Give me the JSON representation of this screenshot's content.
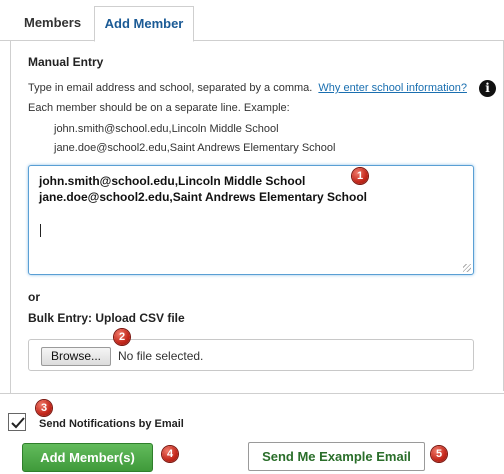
{
  "tabs": [
    {
      "label": "Members"
    },
    {
      "label": "Add Member"
    }
  ],
  "manual_entry": {
    "title": "Manual Entry",
    "instruction_1": "Type in email address and school, separated by a comma.",
    "why_link": "Why enter school information?",
    "info_icon": "i",
    "instruction_2": "Each member should be on a separate line. Example:",
    "examples": [
      "john.smith@school.edu,Lincoln Middle School",
      "jane.doe@school2.edu,Saint Andrews Elementary School"
    ],
    "textarea_lines": [
      "john.smith@school.edu,Lincoln Middle School",
      "jane.doe@school2.edu,Saint Andrews Elementary School"
    ]
  },
  "bulk": {
    "or_label": "or",
    "title": "Bulk Entry: Upload CSV file",
    "browse_label": "Browse...",
    "file_status": "No file selected."
  },
  "notifications": {
    "label": "Send Notifications by Email",
    "checked": true
  },
  "actions": {
    "add_label": "Add Member(s)",
    "example_label": "Send Me Example Email",
    "add_color": "#4caf50"
  },
  "markers": [
    "1",
    "2",
    "3",
    "4",
    "5"
  ],
  "colors": {
    "link": "#1a6fb0",
    "active_tab": "#1a5a95",
    "marker": "#c3271b"
  }
}
